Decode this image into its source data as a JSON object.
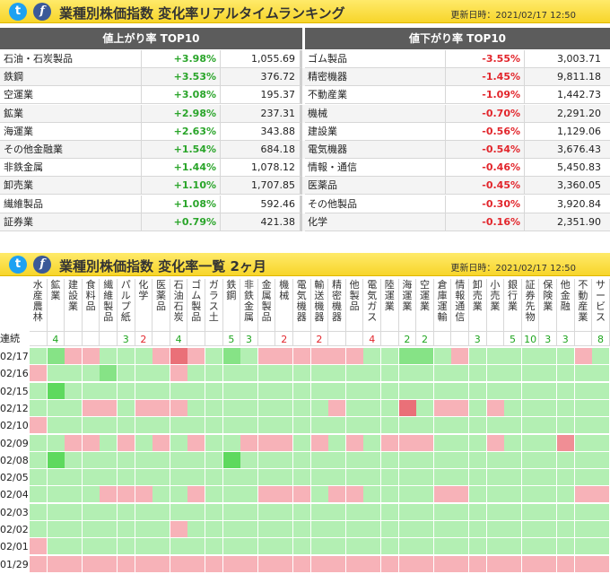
{
  "ranking_panel": {
    "title": "業種別株価指数 変化率リアルタイムランキング",
    "updated": "更新日時：2021/02/17 12:50",
    "up_header": "値上がり率 TOP10",
    "down_header": "値下がり率 TOP10",
    "up": [
      {
        "name": "石油・石炭製品",
        "pct": "+3.98%",
        "value": "1,055.69"
      },
      {
        "name": "鉄鋼",
        "pct": "+3.53%",
        "value": "376.72"
      },
      {
        "name": "空運業",
        "pct": "+3.08%",
        "value": "195.37"
      },
      {
        "name": "鉱業",
        "pct": "+2.98%",
        "value": "237.31"
      },
      {
        "name": "海運業",
        "pct": "+2.63%",
        "value": "343.88"
      },
      {
        "name": "その他金融業",
        "pct": "+1.54%",
        "value": "684.18"
      },
      {
        "name": "非鉄金属",
        "pct": "+1.44%",
        "value": "1,078.12"
      },
      {
        "name": "卸売業",
        "pct": "+1.10%",
        "value": "1,707.85"
      },
      {
        "name": "繊維製品",
        "pct": "+1.08%",
        "value": "592.46"
      },
      {
        "name": "証券業",
        "pct": "+0.79%",
        "value": "421.38"
      }
    ],
    "down": [
      {
        "name": "ゴム製品",
        "pct": "-3.55%",
        "value": "3,003.71"
      },
      {
        "name": "精密機器",
        "pct": "-1.45%",
        "value": "9,811.18"
      },
      {
        "name": "不動産業",
        "pct": "-1.09%",
        "value": "1,442.73"
      },
      {
        "name": "機械",
        "pct": "-0.70%",
        "value": "2,291.20"
      },
      {
        "name": "建設業",
        "pct": "-0.56%",
        "value": "1,129.06"
      },
      {
        "name": "電気機器",
        "pct": "-0.54%",
        "value": "3,676.43"
      },
      {
        "name": "情報・通信",
        "pct": "-0.46%",
        "value": "5,450.83"
      },
      {
        "name": "医薬品",
        "pct": "-0.45%",
        "value": "3,360.05"
      },
      {
        "name": "その他製品",
        "pct": "-0.30%",
        "value": "3,920.84"
      },
      {
        "name": "化学",
        "pct": "-0.16%",
        "value": "2,351.90"
      }
    ]
  },
  "heatmap_panel": {
    "title": "業種別株価指数 変化率一覧 2ヶ月",
    "updated": "更新日時：2021/02/17 12:50",
    "streak_label": "連続",
    "sectors": [
      "水産農林",
      "鉱業",
      "建設業",
      "食料品",
      "繊維製品",
      "パルプ紙",
      "化学",
      "医薬品",
      "石油石炭",
      "ゴム製品",
      "ガラス土",
      "鉄鋼",
      "非鉄金属",
      "金属製品",
      "機械",
      "電気機器",
      "輸送機器",
      "精密機器",
      "他製品",
      "電気ガス",
      "陸運業",
      "海運業",
      "空運業",
      "倉庫運輸",
      "情報通信",
      "卸売業",
      "小売業",
      "銀行業",
      "証券先物",
      "保険業",
      "他金融",
      "不動産業",
      "サービス"
    ],
    "streaks": [
      "",
      "4",
      "",
      "",
      "",
      "3",
      "2",
      "",
      "4",
      "",
      "",
      "5",
      "3",
      "",
      "2",
      "",
      "2",
      "",
      "",
      "4",
      "",
      "2",
      "2",
      "",
      "",
      "3",
      "",
      "5",
      "10",
      "3",
      "3",
      "",
      "8"
    ],
    "streak_up": [
      false,
      true,
      false,
      false,
      false,
      true,
      false,
      false,
      true,
      false,
      false,
      true,
      true,
      false,
      false,
      false,
      false,
      false,
      false,
      false,
      false,
      true,
      true,
      false,
      false,
      true,
      false,
      true,
      true,
      true,
      true,
      false,
      true
    ],
    "dates": [
      "02/17",
      "02/16",
      "02/15",
      "02/12",
      "02/10",
      "02/09",
      "02/08",
      "02/05",
      "02/04",
      "02/03",
      "02/02",
      "02/01",
      "01/29"
    ],
    "grid": [
      [
        "g1",
        "G2",
        "r1",
        "r1",
        "g1",
        "g1",
        "g1",
        "r1",
        "R3",
        "r1",
        "g1",
        "G2",
        "g1",
        "r1",
        "r1",
        "r1",
        "r1",
        "r1",
        "r1",
        "g1",
        "g1",
        "G2",
        "G2",
        "g1",
        "r1",
        "g1",
        "g1",
        "g1",
        "g1",
        "g1",
        "g1",
        "r1",
        "g1"
      ],
      [
        "r1",
        "g1",
        "g1",
        "g1",
        "G2",
        "g1",
        "g1",
        "g1",
        "r1",
        "g1",
        "g1",
        "g1",
        "g1",
        "g1",
        "g1",
        "g1",
        "g1",
        "g1",
        "g1",
        "g1",
        "g1",
        "g1",
        "g1",
        "g1",
        "g1",
        "g1",
        "g1",
        "g1",
        "g1",
        "g1",
        "g1",
        "g1",
        "g1"
      ],
      [
        "g1",
        "G3",
        "g1",
        "g1",
        "g1",
        "g1",
        "g1",
        "g1",
        "g1",
        "g1",
        "g1",
        "g1",
        "g1",
        "g1",
        "g1",
        "g1",
        "g1",
        "g1",
        "g1",
        "g1",
        "g1",
        "g1",
        "g1",
        "g1",
        "g1",
        "g1",
        "g1",
        "g1",
        "g1",
        "g1",
        "g1",
        "g1",
        "g1"
      ],
      [
        "g1",
        "g1",
        "g1",
        "r1",
        "r1",
        "g1",
        "r1",
        "r1",
        "r1",
        "g1",
        "g1",
        "g1",
        "g1",
        "g1",
        "g1",
        "g1",
        "g1",
        "r1",
        "g1",
        "g1",
        "g1",
        "R3",
        "g1",
        "r1",
        "r1",
        "g1",
        "r1",
        "g1",
        "g1",
        "g1",
        "g1",
        "g1",
        "g1"
      ],
      [
        "r1",
        "g1",
        "g1",
        "g1",
        "g1",
        "g1",
        "g1",
        "g1",
        "g1",
        "g1",
        "g1",
        "g1",
        "g1",
        "g1",
        "g1",
        "g1",
        "g1",
        "g1",
        "g1",
        "g1",
        "g1",
        "g1",
        "g1",
        "g1",
        "g1",
        "g1",
        "g1",
        "g1",
        "g1",
        "g1",
        "g1",
        "g1",
        "g1"
      ],
      [
        "g1",
        "g1",
        "r1",
        "r1",
        "g1",
        "r1",
        "g1",
        "r1",
        "g1",
        "r1",
        "g1",
        "g1",
        "r1",
        "r1",
        "r1",
        "g1",
        "r1",
        "g1",
        "r1",
        "g1",
        "r1",
        "r1",
        "r1",
        "g1",
        "g1",
        "g1",
        "r1",
        "g1",
        "g1",
        "g1",
        "R2",
        "g1",
        "g1"
      ],
      [
        "g1",
        "G3",
        "g1",
        "g1",
        "g1",
        "g1",
        "g1",
        "g1",
        "g1",
        "g1",
        "g1",
        "G3",
        "g1",
        "g1",
        "g1",
        "g1",
        "g1",
        "g1",
        "g1",
        "g1",
        "g1",
        "g1",
        "g1",
        "g1",
        "g1",
        "g1",
        "g1",
        "g1",
        "g1",
        "g1",
        "g1",
        "g1",
        "g1"
      ],
      [
        "g1",
        "g1",
        "g1",
        "g1",
        "g1",
        "g1",
        "g1",
        "g1",
        "g1",
        "g1",
        "g1",
        "g1",
        "g1",
        "g1",
        "g1",
        "g1",
        "g1",
        "g1",
        "g1",
        "g1",
        "g1",
        "g1",
        "g1",
        "g1",
        "g1",
        "g1",
        "g1",
        "g1",
        "g1",
        "g1",
        "g1",
        "g1",
        "g1"
      ],
      [
        "g1",
        "g1",
        "g1",
        "g1",
        "r1",
        "r1",
        "r1",
        "g1",
        "g1",
        "r1",
        "g1",
        "g1",
        "g1",
        "r1",
        "r1",
        "r1",
        "g1",
        "r1",
        "r1",
        "g1",
        "g1",
        "g1",
        "g1",
        "r1",
        "r1",
        "g1",
        "g1",
        "g1",
        "g1",
        "g1",
        "g1",
        "r1",
        "r1"
      ],
      [
        "g1",
        "g1",
        "g1",
        "g1",
        "g1",
        "g1",
        "g1",
        "g1",
        "g1",
        "g1",
        "g1",
        "g1",
        "g1",
        "g1",
        "g1",
        "g1",
        "g1",
        "g1",
        "g1",
        "g1",
        "g1",
        "g1",
        "g1",
        "g1",
        "g1",
        "g1",
        "g1",
        "g1",
        "g1",
        "g1",
        "g1",
        "g1",
        "g1"
      ],
      [
        "g1",
        "g1",
        "g1",
        "g1",
        "g1",
        "g1",
        "g1",
        "g1",
        "r1",
        "g1",
        "g1",
        "g1",
        "g1",
        "g1",
        "g1",
        "g1",
        "g1",
        "g1",
        "g1",
        "g1",
        "g1",
        "g1",
        "g1",
        "g1",
        "g1",
        "g1",
        "g1",
        "g1",
        "g1",
        "g1",
        "g1",
        "g1",
        "g1"
      ],
      [
        "r1",
        "g1",
        "g1",
        "g1",
        "g1",
        "g1",
        "g1",
        "g1",
        "g1",
        "g1",
        "g1",
        "g1",
        "g1",
        "g1",
        "g1",
        "g1",
        "g1",
        "g1",
        "g1",
        "g1",
        "g1",
        "g1",
        "g1",
        "g1",
        "g1",
        "g1",
        "g1",
        "g1",
        "g1",
        "g1",
        "g1",
        "g1",
        "g1"
      ],
      [
        "r1",
        "r1",
        "r1",
        "r1",
        "r1",
        "r1",
        "r1",
        "r1",
        "r1",
        "r1",
        "r1",
        "r1",
        "r1",
        "r1",
        "r1",
        "r1",
        "r1",
        "r1",
        "r1",
        "r1",
        "r1",
        "r1",
        "r1",
        "r1",
        "r1",
        "r1",
        "r1",
        "r1",
        "r1",
        "r1",
        "r1",
        "r1",
        "r1"
      ]
    ],
    "colors": {
      "g1": "#b3efb3",
      "G2": "#86e386",
      "G3": "#5ed95e",
      "r1": "#f7b2b8",
      "R2": "#f08e95",
      "R3": "#ea7078"
    }
  }
}
